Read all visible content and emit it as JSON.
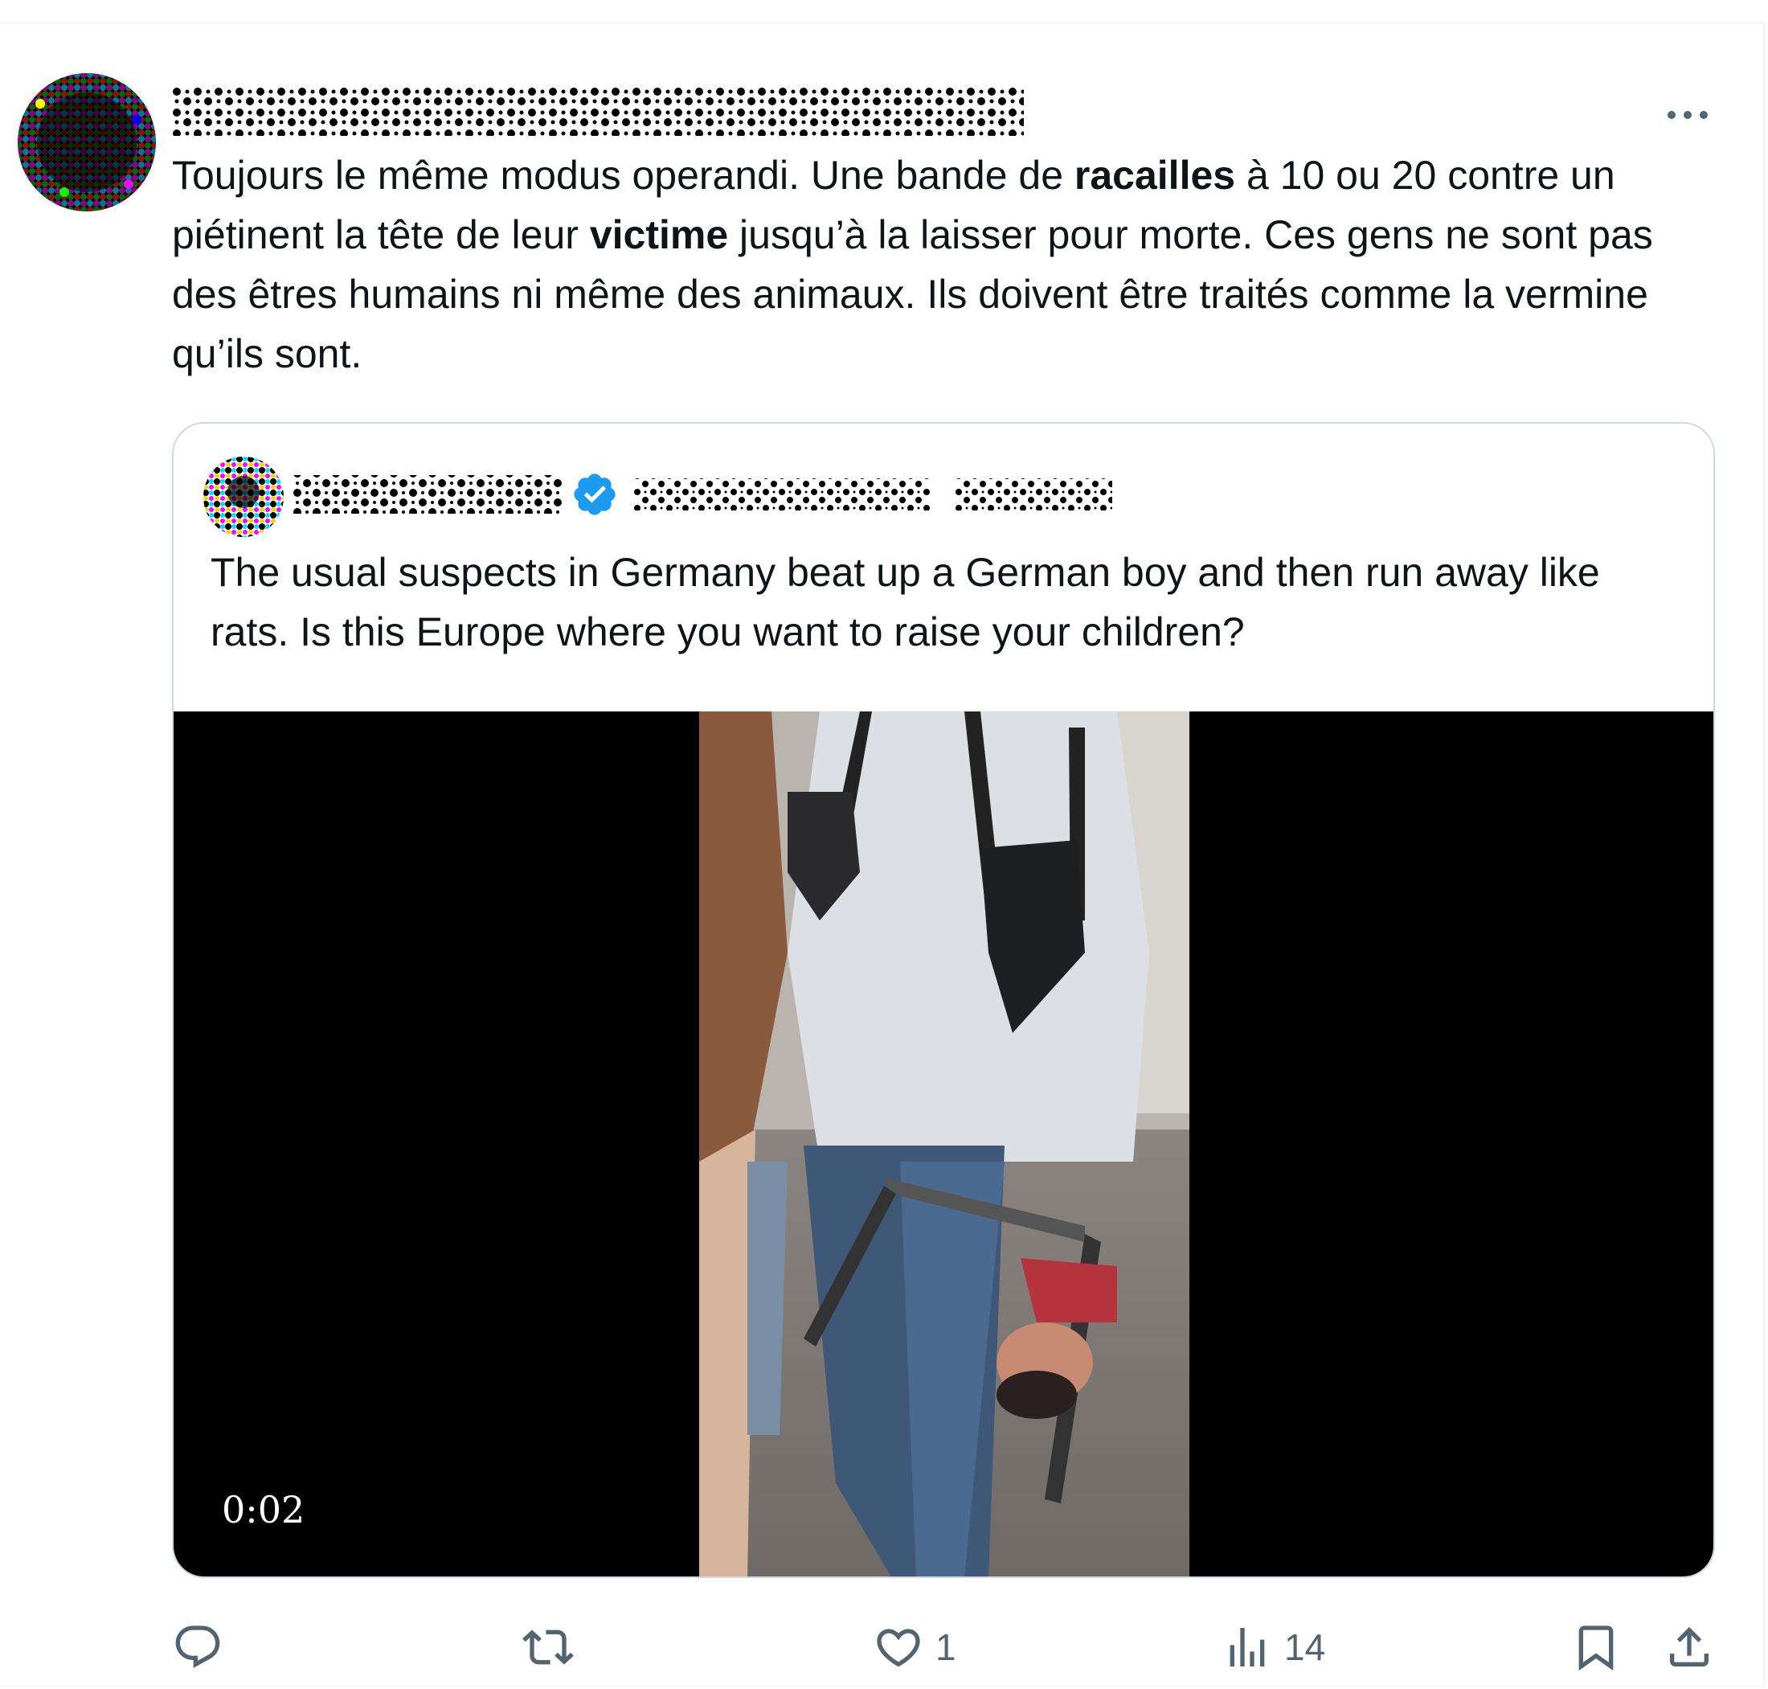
{
  "post": {
    "author_name": "",
    "text": {
      "part1": "Toujours le même modus operandi. Une bande de ",
      "bold1": "racailles",
      "part2": " à 10 ou 20 contre un piétinent la tête de leur ",
      "bold2": "victime",
      "part3": " jusqu’à la laisser pour morte. Ces gens ne sont pas des êtres humains ni même des animaux. Ils doivent être traités comme la vermine qu’ils sont."
    },
    "more_icon": "more-dots-icon"
  },
  "quote": {
    "text": "The usual suspects in Germany beat up a German boy and then run away like rats. Is this Europe where you want to raise your children?",
    "verified_icon": "verified-badge-icon",
    "verified_color": "#1d9bf0",
    "video_duration": "0:02"
  },
  "actions": {
    "reply_icon": "reply-icon",
    "repost_icon": "repost-icon",
    "like_icon": "heart-icon",
    "like_count": "1",
    "views_icon": "views-chart-icon",
    "views_count": "14",
    "bookmark_icon": "bookmark-icon",
    "share_icon": "share-icon"
  },
  "colors": {
    "text": "#0f1419",
    "muted": "#536471",
    "border": "#cfd9de",
    "accent": "#1d9bf0"
  }
}
